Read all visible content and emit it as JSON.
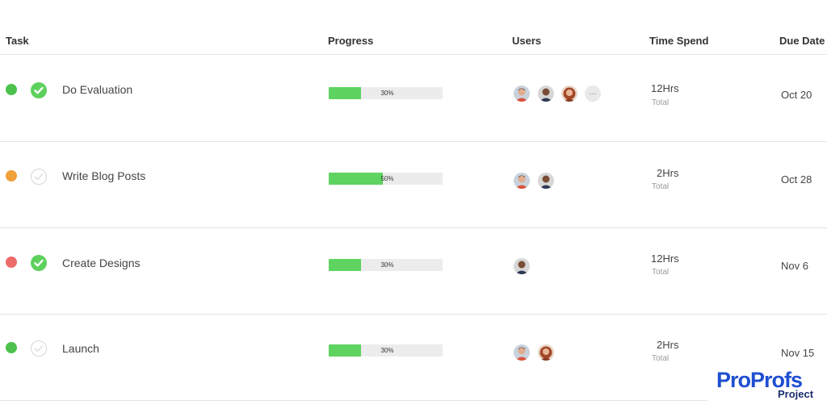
{
  "columns": {
    "task": "Task",
    "progress": "Progress",
    "users": "Users",
    "time_spend": "Time Spend",
    "due_date": "Due Date"
  },
  "rows": [
    {
      "status_color": "#4cc24c",
      "completed": true,
      "name": "Do Evaluation",
      "progress": 30,
      "progress_label": "30%",
      "users": [
        "man-avatar",
        "dark-man-avatar",
        "woman-avatar"
      ],
      "more_users": "...",
      "time": "12Hrs",
      "time_sub": "Total",
      "due": "Oct 20"
    },
    {
      "status_color": "#f2a03a",
      "completed": false,
      "name": "Write Blog Posts",
      "progress": 50,
      "progress_label": "50%",
      "users": [
        "man-avatar",
        "dark-man-avatar"
      ],
      "time": "2Hrs",
      "time_sub": "Total",
      "due": "Oct 28"
    },
    {
      "status_color": "#ee6b6b",
      "completed": true,
      "name": "Create Designs",
      "progress": 30,
      "progress_label": "30%",
      "users": [
        "dark-man-avatar"
      ],
      "time": "12Hrs",
      "time_sub": "Total",
      "due": "Nov 6"
    },
    {
      "status_color": "#4cc24c",
      "completed": false,
      "name": "Launch",
      "progress": 30,
      "progress_label": "30%",
      "users": [
        "man-avatar",
        "woman-avatar"
      ],
      "time": "2Hrs",
      "time_sub": "Total",
      "due": "Nov 15"
    }
  ],
  "logo": {
    "main": "ProProfs",
    "sub": "Project"
  }
}
